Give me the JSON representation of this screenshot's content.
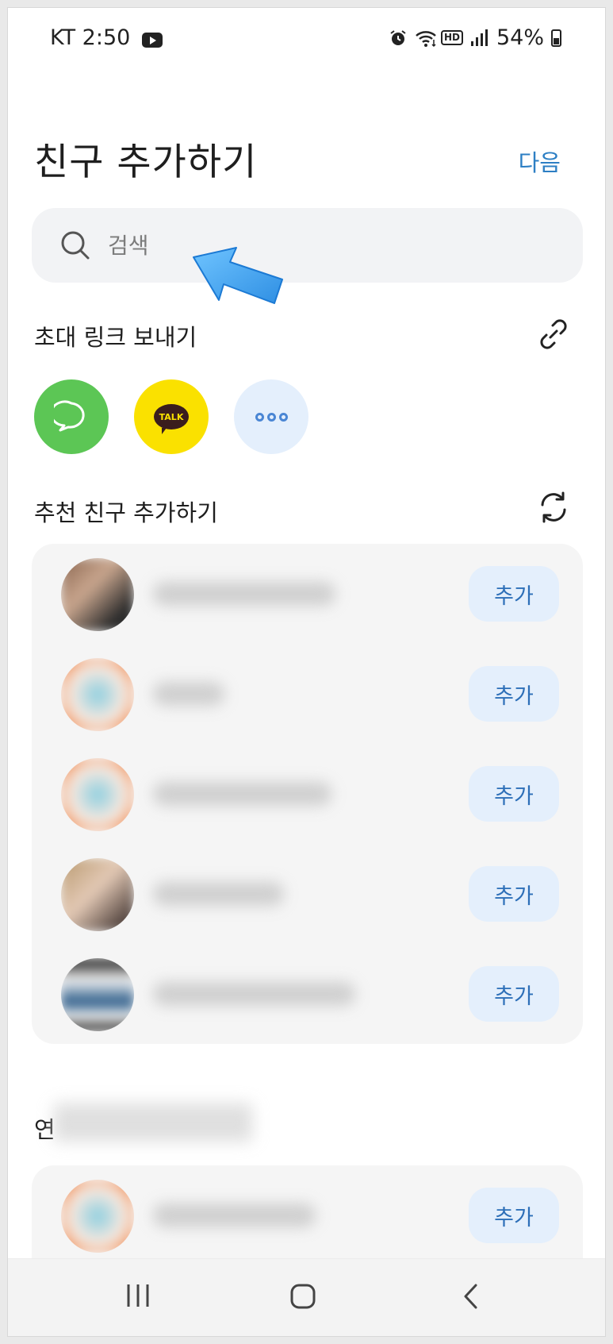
{
  "status_bar": {
    "carrier_time": "KT 2:50",
    "battery": "54%",
    "hd_label": "HD"
  },
  "header": {
    "title": "친구 추가하기",
    "next_label": "다음"
  },
  "search": {
    "placeholder": "검색"
  },
  "invite": {
    "title": "초대 링크 보내기",
    "talk_label": "TALK",
    "targets": [
      "messages-icon",
      "kakaotalk-icon",
      "more-icon"
    ]
  },
  "recommended": {
    "title": "추천 친구 추가하기",
    "add_label": "추가",
    "count_visible": 5
  },
  "contacts": {
    "title_prefix": "연",
    "add_label": "추가"
  },
  "colors": {
    "accent": "#2d7fc4",
    "add_button_bg": "#e4effc",
    "messages_green": "#5cc655",
    "kakao_yellow": "#fae100",
    "arrow_blue": "#3aa3ee"
  }
}
